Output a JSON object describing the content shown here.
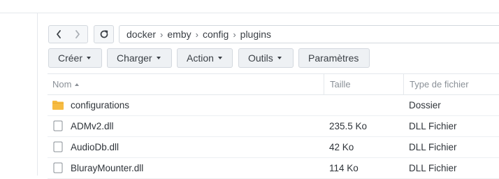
{
  "nav": {
    "back_icon": "chevron-left-icon",
    "forward_icon": "chevron-right-icon",
    "refresh_icon": "refresh-icon"
  },
  "path": {
    "segments": [
      "docker",
      "emby",
      "config",
      "plugins"
    ],
    "separator": "›"
  },
  "toolbar": {
    "create_label": "Créer",
    "upload_label": "Charger",
    "action_label": "Action",
    "tools_label": "Outils",
    "settings_label": "Paramètres"
  },
  "table": {
    "columns": {
      "name": "Nom",
      "size": "Taille",
      "type": "Type de fichier"
    },
    "rows": [
      {
        "icon": "folder-icon",
        "name": "configurations",
        "size": "",
        "type": "Dossier"
      },
      {
        "icon": "file-icon",
        "name": "ADMv2.dll",
        "size": "235.5 Ko",
        "type": "DLL Fichier"
      },
      {
        "icon": "file-icon",
        "name": "AudioDb.dll",
        "size": "42 Ko",
        "type": "DLL Fichier"
      },
      {
        "icon": "file-icon",
        "name": "BlurayMounter.dll",
        "size": "114 Ko",
        "type": "DLL Fichier"
      }
    ]
  },
  "colors": {
    "folder": "#f6bb42",
    "button_bg": "#eef1f4",
    "border": "#d3d8de"
  }
}
